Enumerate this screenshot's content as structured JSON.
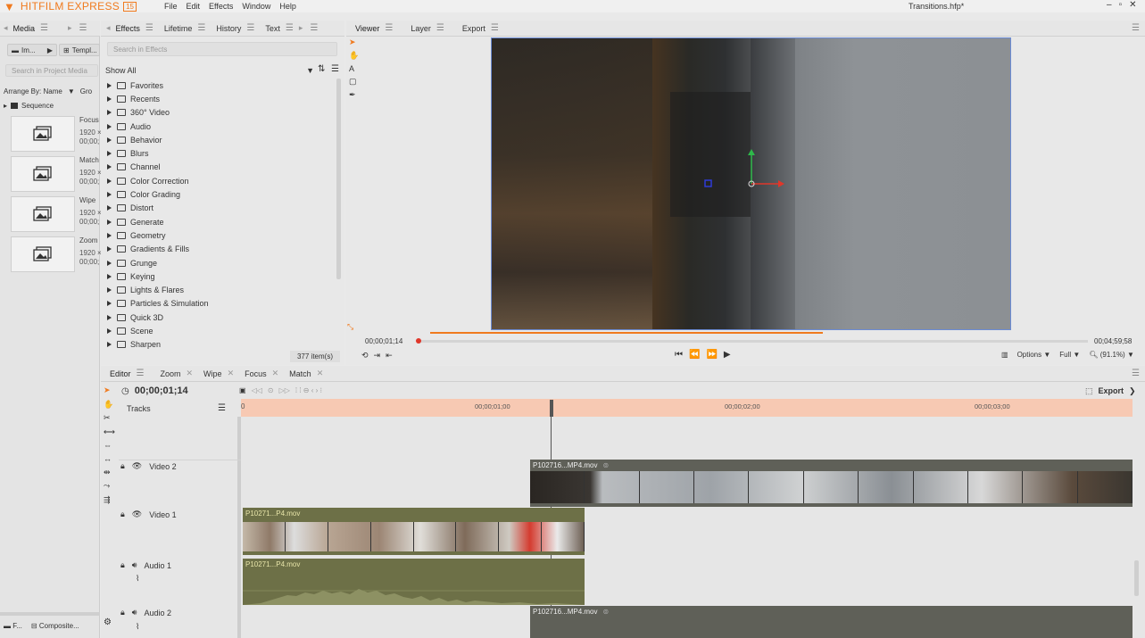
{
  "app": {
    "name": "HITFILM EXPRESS",
    "version": "15",
    "window_title": "Transitions.hfp*"
  },
  "menu": [
    "File",
    "Edit",
    "Effects",
    "Window",
    "Help"
  ],
  "media_panel": {
    "tabs": [
      "Media"
    ],
    "import_label": "Im...",
    "templates_label": "Templ...",
    "search_placeholder": "Search in Project Media",
    "arrange_label": "Arrange By: Name",
    "group_label": "Gro",
    "folder": "Sequence",
    "items": [
      {
        "name": "Focus",
        "res": "1920 ×",
        "dur": "00;00;"
      },
      {
        "name": "Match",
        "res": "1920 ×",
        "dur": "00;00;"
      },
      {
        "name": "Wipe",
        "res": "1920 ×",
        "dur": "00;00;"
      },
      {
        "name": "Zoom",
        "res": "1920 ×",
        "dur": "00;00;"
      }
    ],
    "bottom_tabs": [
      "F...",
      "Composite..."
    ]
  },
  "effects_panel": {
    "tabs": [
      "Effects",
      "Lifetime",
      "History",
      "Text"
    ],
    "search_placeholder": "Search in Effects",
    "filter": "Show All",
    "categories": [
      "Favorites",
      "Recents",
      "360° Video",
      "Audio",
      "Behavior",
      "Blurs",
      "Channel",
      "Color Correction",
      "Color Grading",
      "Distort",
      "Generate",
      "Geometry",
      "Gradients & Fills",
      "Grunge",
      "Keying",
      "Lights & Flares",
      "Particles & Simulation",
      "Quick 3D",
      "Scene",
      "Sharpen"
    ],
    "count": "377 item(s)"
  },
  "viewer_panel": {
    "tabs": [
      "Viewer",
      "Layer",
      "Export"
    ],
    "current_time": "00;00;01;14",
    "end_time": "00;04;59;58",
    "playhead_fraction": 0.0,
    "options_label": "Options",
    "quality_label": "Full",
    "zoom_label": "(91.1%)"
  },
  "editor_panel": {
    "tabs": [
      "Editor",
      "Zoom",
      "Wipe",
      "Focus",
      "Match"
    ],
    "timecode": "00;00;01;14",
    "tracks_label": "Tracks",
    "export_label": "Export",
    "ruler": [
      "0",
      "00;00;01;00",
      "00;00;02;00",
      "00;00;03;00"
    ],
    "tracks": [
      {
        "name": "Video 2",
        "clip": "P102716...MP4.mov"
      },
      {
        "name": "Video 1",
        "clip": "P10271...P4.mov"
      },
      {
        "name": "Audio 1",
        "clip": "P10271...P4.mov"
      },
      {
        "name": "Audio 2",
        "clip": "P102716...MP4.mov"
      }
    ]
  },
  "colors": {
    "accent": "#f07a1e",
    "ruler": "#f7c9b3",
    "video_clip": "#5f6058",
    "audio_clip": "#6d7047",
    "frame_border": "#6b8bd4"
  }
}
